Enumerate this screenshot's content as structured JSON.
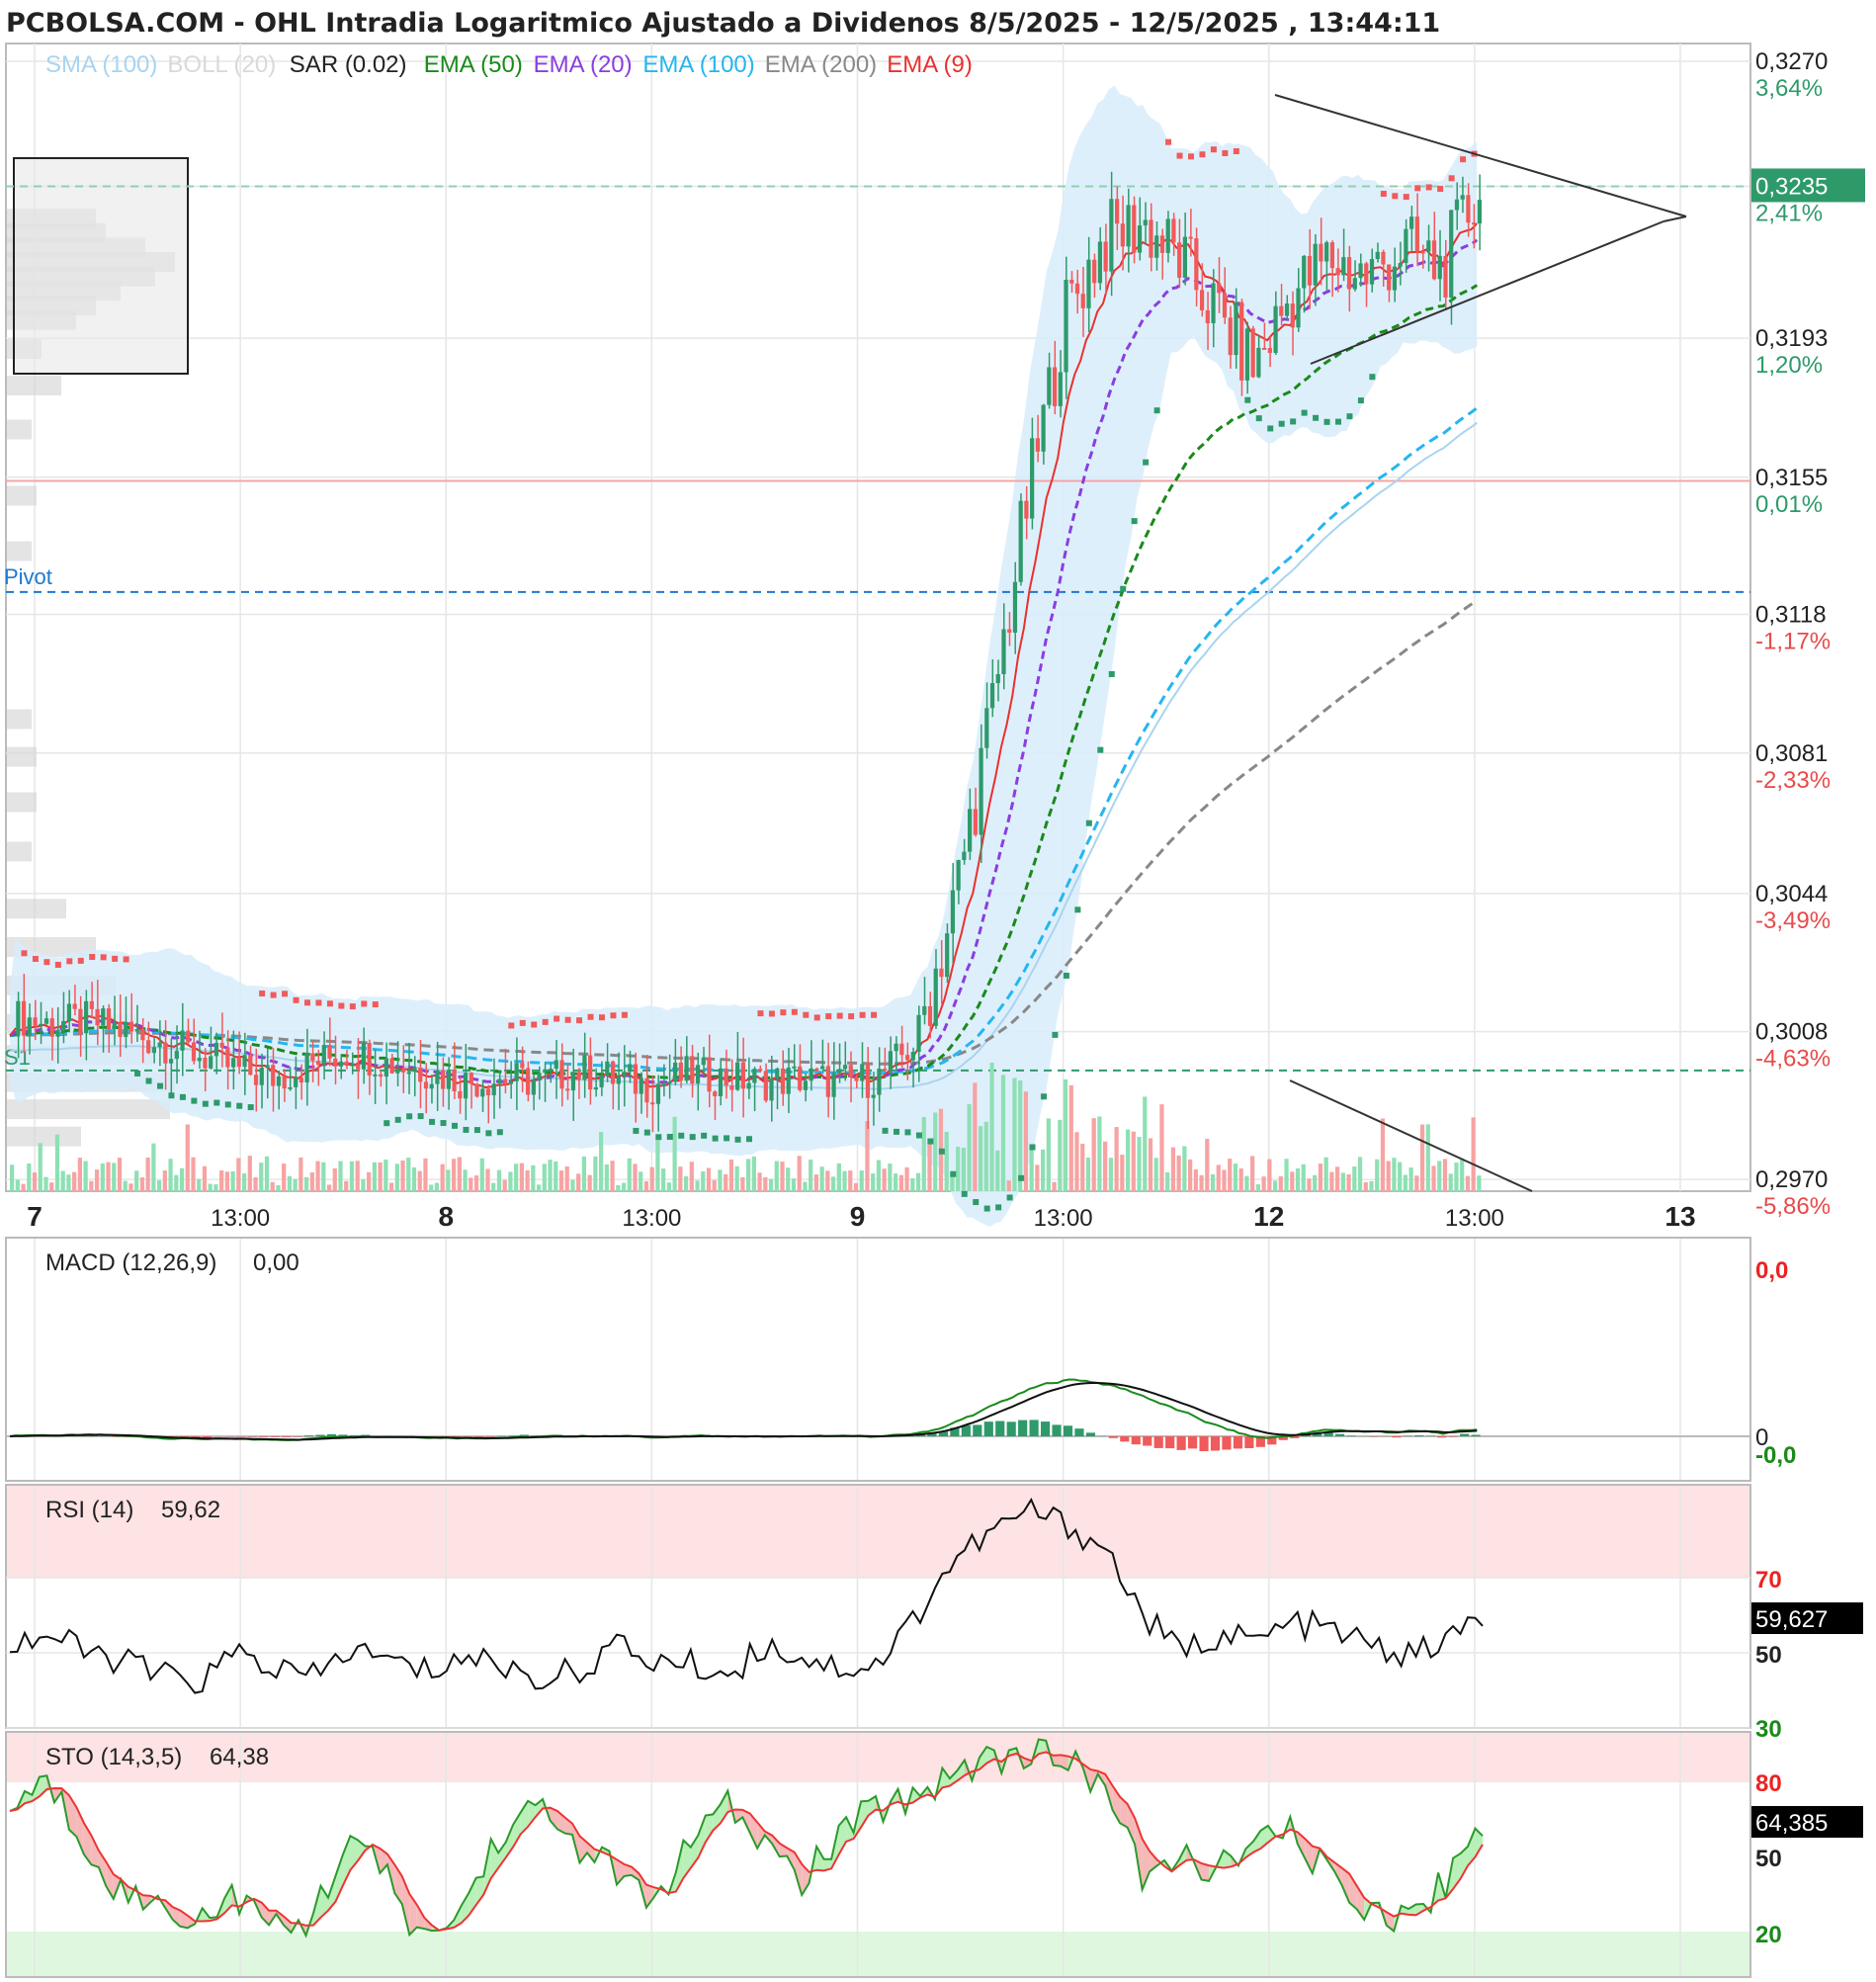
{
  "header": {
    "title": "PCBOLSA.COM - OHL Intradia Logaritmico Ajustado a Dividenos 8/5/2025 - 12/5/2025 , 13:44:11"
  },
  "legend": [
    {
      "label": "SMA (100)",
      "color": "#a9d4f0"
    },
    {
      "label": "BOLL (20)",
      "color": "#d9d9d9"
    },
    {
      "label": "SAR (0.02)",
      "color": "#222222"
    },
    {
      "label": "EMA (50)",
      "color": "#1a8a1a"
    },
    {
      "label": "EMA (20)",
      "color": "#8a3ee0"
    },
    {
      "label": "EMA (100)",
      "color": "#25b6ef"
    },
    {
      "label": "EMA (200)",
      "color": "#888888"
    },
    {
      "label": "EMA (9)",
      "color": "#e8312f"
    }
  ],
  "colors": {
    "up": "#2e9a6a",
    "down": "#f05a5a",
    "sar": "#f05a5a",
    "sar_green": "#2e9a6a",
    "pivot": "#1f78d1",
    "s1": "#2e9a6a",
    "resistance": "#f4a6a6",
    "bollinger_fill": "#d8ecfb",
    "overbought_zone": "#fde3e3",
    "oversold_zone": "#dff7df",
    "grid": "#e6e6e6"
  },
  "levels": {
    "pivot_label": "Pivot",
    "s1_label": "S1",
    "pivot_value": 0.3124,
    "s1_value": 0.2998,
    "resistance_value": 0.3154,
    "last_price": "0,3235"
  },
  "chart_data": [
    {
      "type": "candlestick",
      "title": "OHL Intradia Logaritmico Ajustado a Dividenos 8/5/2025 - 12/5/2025",
      "scale": "log",
      "y_ticks": [
        {
          "price": "0,3270",
          "pct": "3,64%"
        },
        {
          "price": "0,3235",
          "pct": "2,41%"
        },
        {
          "price": "0,3193",
          "pct": "1,20%"
        },
        {
          "price": "0,3155",
          "pct": "0,01%"
        },
        {
          "price": "0,3118",
          "pct": "-1,17%"
        },
        {
          "price": "0,3081",
          "pct": "-2,33%"
        },
        {
          "price": "0,3044",
          "pct": "-3,49%"
        },
        {
          "price": "0,3008",
          "pct": "-4,63%"
        },
        {
          "price": "0,2970",
          "pct": "-5,86%"
        }
      ],
      "x_ticks": [
        "7",
        "13:00",
        "8",
        "13:00",
        "9",
        "13:00",
        "12",
        "13:00",
        "13"
      ],
      "ylim": [
        0.2967,
        0.3275
      ],
      "last_value": "0,3235",
      "approx_close_path": [
        0.3012,
        0.301,
        0.3011,
        0.3008,
        0.3005,
        0.3002,
        0.2998,
        0.2996,
        0.3,
        0.3003,
        0.3,
        0.2998,
        0.2995,
        0.2996,
        0.2995,
        0.2998,
        0.2996,
        0.2994,
        0.2997,
        0.2996,
        0.2995,
        0.2996,
        0.2995,
        0.2996,
        0.3005,
        0.304,
        0.309,
        0.315,
        0.32,
        0.322,
        0.3225,
        0.3215,
        0.32,
        0.3185,
        0.3205,
        0.3215,
        0.321,
        0.3218,
        0.3212,
        0.3235
      ]
    },
    {
      "type": "line",
      "title": "MACD (12,26,9)",
      "value": "0,00",
      "y_ticks": [
        "0,0",
        "0",
        "-0,0"
      ]
    },
    {
      "type": "line",
      "title": "RSI (14)",
      "value": "59,62",
      "last_value": "59,627",
      "y_ticks": [
        "70",
        "50",
        "30"
      ],
      "approx_values": [
        52,
        55,
        50,
        48,
        44,
        42,
        50,
        46,
        43,
        51,
        48,
        45,
        49,
        47,
        43,
        45,
        52,
        48,
        47,
        44,
        52,
        49,
        46,
        47,
        60,
        75,
        82,
        88,
        84,
        78,
        60,
        50,
        55,
        53,
        58,
        56,
        52,
        49,
        53,
        59.6
      ]
    },
    {
      "type": "line",
      "title": "STO (14,3,5)",
      "value": "64,38",
      "last_value": "64,385",
      "y_ticks": [
        "80",
        "50",
        "20"
      ],
      "approx_values": [
        70,
        80,
        55,
        35,
        30,
        25,
        35,
        20,
        25,
        60,
        40,
        15,
        30,
        60,
        70,
        55,
        45,
        30,
        55,
        70,
        55,
        40,
        60,
        70,
        75,
        85,
        90,
        92,
        88,
        80,
        40,
        50,
        45,
        55,
        60,
        40,
        30,
        25,
        40,
        64.4
      ]
    }
  ]
}
